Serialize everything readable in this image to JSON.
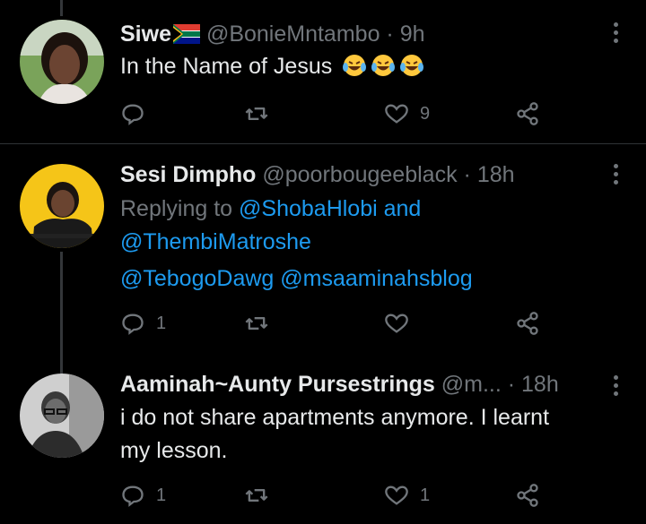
{
  "tweets": [
    {
      "name": "Siwe",
      "handle": "@BonieMntambo",
      "dot": "·",
      "time": "9h",
      "text": "In the Name of Jesus",
      "emoji_name": "face-with-tears-of-joy",
      "emoji_count": 3,
      "replies": "",
      "likes": "9"
    },
    {
      "name": "Sesi Dimpho",
      "handle": "@poorbougeeblack",
      "dot": "·",
      "time": "18h",
      "replying_prefix": "Replying to",
      "reply_to_1": "@ShobaHlobi",
      "reply_and": "and",
      "reply_to_2": "@ThembiMatroshe",
      "text": "@TebogoDawg @msaaminahsblog",
      "replies": "1",
      "likes": ""
    },
    {
      "name": "Aaminah~Aunty Pursestrings",
      "handle": "@m...",
      "dot": "·",
      "time": "18h",
      "text_line1": "i do not share apartments anymore. I learnt",
      "text_line2": "my lesson.",
      "replies": "1",
      "likes": "1"
    }
  ],
  "colors": {
    "background": "#000000",
    "muted": "#71767b",
    "link": "#1d9bf0",
    "divider": "#2f3336"
  }
}
